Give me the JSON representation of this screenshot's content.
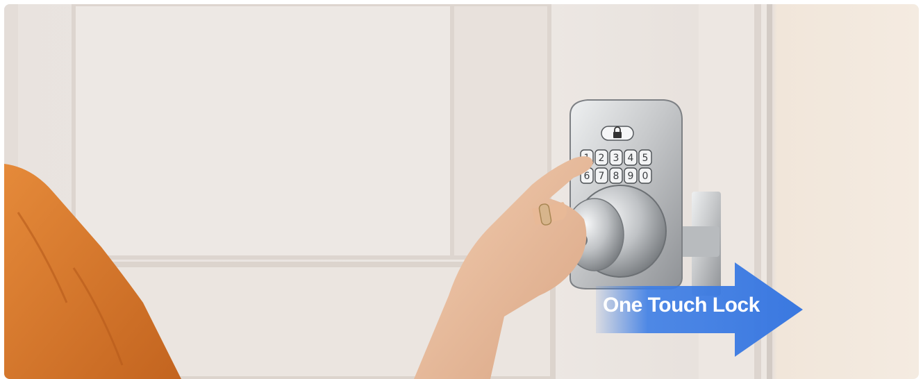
{
  "banner": {
    "caption": "One Touch Lock"
  },
  "keypad": {
    "keys": [
      "1",
      "2",
      "3",
      "4",
      "5",
      "6",
      "7",
      "8",
      "9",
      "0"
    ]
  },
  "colors": {
    "door": "#ebe5e1",
    "wall": "#f3e9de",
    "arrow": "#3d7ee6",
    "lock_metal": "#c9cacc",
    "sleeve": "#d9772a"
  },
  "icons": {
    "lock_button": "padlock-icon"
  }
}
